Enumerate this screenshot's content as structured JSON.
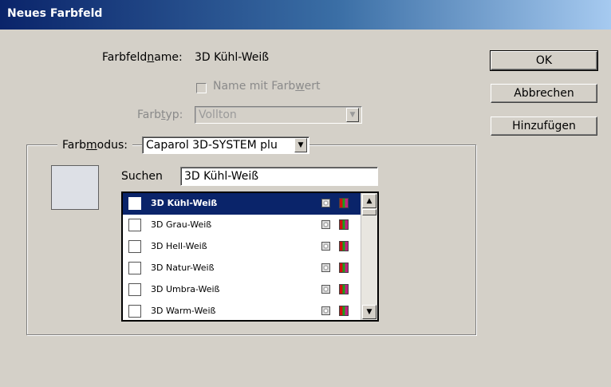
{
  "window": {
    "title": "Neues Farbfeld"
  },
  "form": {
    "name_label": "Farbfeldname:",
    "name_value": "3D Kühl-Weiß",
    "name_with_value_label": "Name mit Farbwert",
    "color_type_label": "Farbtyp:",
    "color_type_value": "Vollton",
    "color_mode_label": "Farbmodus:",
    "color_mode_value": "Caparol 3D-SYSTEM plu",
    "search_label": "Suchen",
    "search_value": "3D Kühl-Weiß"
  },
  "buttons": {
    "ok": "OK",
    "cancel": "Abbrechen",
    "add": "Hinzufügen"
  },
  "swatch_list": {
    "items": [
      {
        "label": "3D Kühl-Weiß",
        "selected": true
      },
      {
        "label": "3D Grau-Weiß"
      },
      {
        "label": "3D Hell-Weiß"
      },
      {
        "label": "3D Natur-Weiß"
      },
      {
        "label": "3D Umbra-Weiß"
      },
      {
        "label": "3D Warm-Weiß"
      }
    ]
  },
  "icons": {
    "spot": "spot-color-icon",
    "mode": "rgb-mode-icon",
    "dropdown": "chevron-down-icon",
    "scroll_up": "scroll-up-arrow-icon",
    "scroll_down": "scroll-down-arrow-icon"
  },
  "colors": {
    "title_start": "#0a246a",
    "title_end": "#a6caf0",
    "selection": "#0a246a",
    "dialog": "#d4d0c8",
    "preview_swatch": "#dde0e6"
  }
}
